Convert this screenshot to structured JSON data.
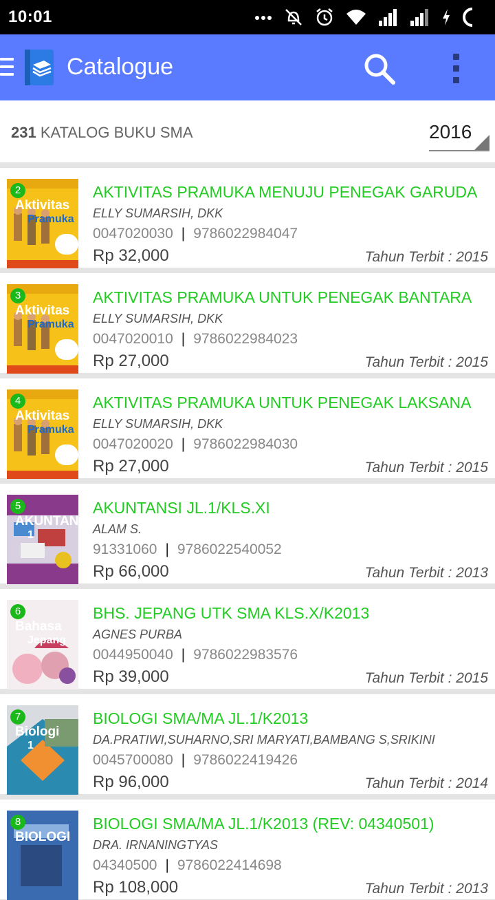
{
  "status": {
    "time": "10:01"
  },
  "appbar": {
    "title": "Catalogue"
  },
  "header": {
    "count": "231",
    "label": "KATALOG BUKU SMA",
    "year": "2016"
  },
  "books": [
    {
      "num": "2",
      "title": "AKTIVITAS PRAMUKA MENUJU PENEGAK GARUDA",
      "author": "ELLY SUMARSIH, DKK",
      "code": "0047020030",
      "isbn": "9786022984047",
      "price": "Rp 32,000",
      "year": "Tahun Terbit : 2015",
      "cover": "pramuka",
      "cover_text": "Aktivitas",
      "cover_sub": "Pramuka"
    },
    {
      "num": "3",
      "title": "AKTIVITAS PRAMUKA UNTUK PENEGAK BANTARA",
      "author": "ELLY SUMARSIH, DKK",
      "code": "0047020010",
      "isbn": "9786022984023",
      "price": "Rp 27,000",
      "year": "Tahun Terbit : 2015",
      "cover": "pramuka",
      "cover_text": "Aktivitas",
      "cover_sub": "Pramuka"
    },
    {
      "num": "4",
      "title": "AKTIVITAS PRAMUKA UNTUK PENEGAK LAKSANA",
      "author": "ELLY SUMARSIH, DKK",
      "code": "0047020020",
      "isbn": "9786022984030",
      "price": "Rp 27,000",
      "year": "Tahun Terbit : 2015",
      "cover": "pramuka",
      "cover_text": "Aktivitas",
      "cover_sub": "Pramuka"
    },
    {
      "num": "5",
      "title": "AKUNTANSI JL.1/KLS.XI",
      "author": "ALAM S.",
      "code": "91331060",
      "isbn": "9786022540052",
      "price": "Rp 66,000",
      "year": "Tahun Terbit : 2013",
      "cover": "akuntansi",
      "cover_text": "AKUNTANSI",
      "cover_sub": "1"
    },
    {
      "num": "6",
      "title": "BHS. JEPANG UTK SMA KLS.X/K2013",
      "author": "AGNES PURBA",
      "code": "0044950040",
      "isbn": "9786022983576",
      "price": "Rp 39,000",
      "year": "Tahun Terbit : 2015",
      "cover": "jepang",
      "cover_text": "Bahasa",
      "cover_sub": "Jepang"
    },
    {
      "num": "7",
      "title": "BIOLOGI SMA/MA JL.1/K2013",
      "author": "DA.PRATIWI,SUHARNO,SRI MARYATI,BAMBANG S,SRIKINI",
      "code": "0045700080",
      "isbn": "9786022419426",
      "price": "Rp 96,000",
      "year": "Tahun Terbit : 2014",
      "cover": "biologi",
      "cover_text": "Biologi",
      "cover_sub": "1"
    },
    {
      "num": "8",
      "title": "BIOLOGI SMA/MA JL.1/K2013 (REV: 04340501)",
      "author": "DRA. IRNANINGTYAS",
      "code": "04340500",
      "isbn": "9786022414698",
      "price": "Rp 108,000",
      "year": "Tahun Terbit : 2013",
      "cover": "biologi2",
      "cover_text": "BIOLOGI",
      "cover_sub": ""
    }
  ]
}
